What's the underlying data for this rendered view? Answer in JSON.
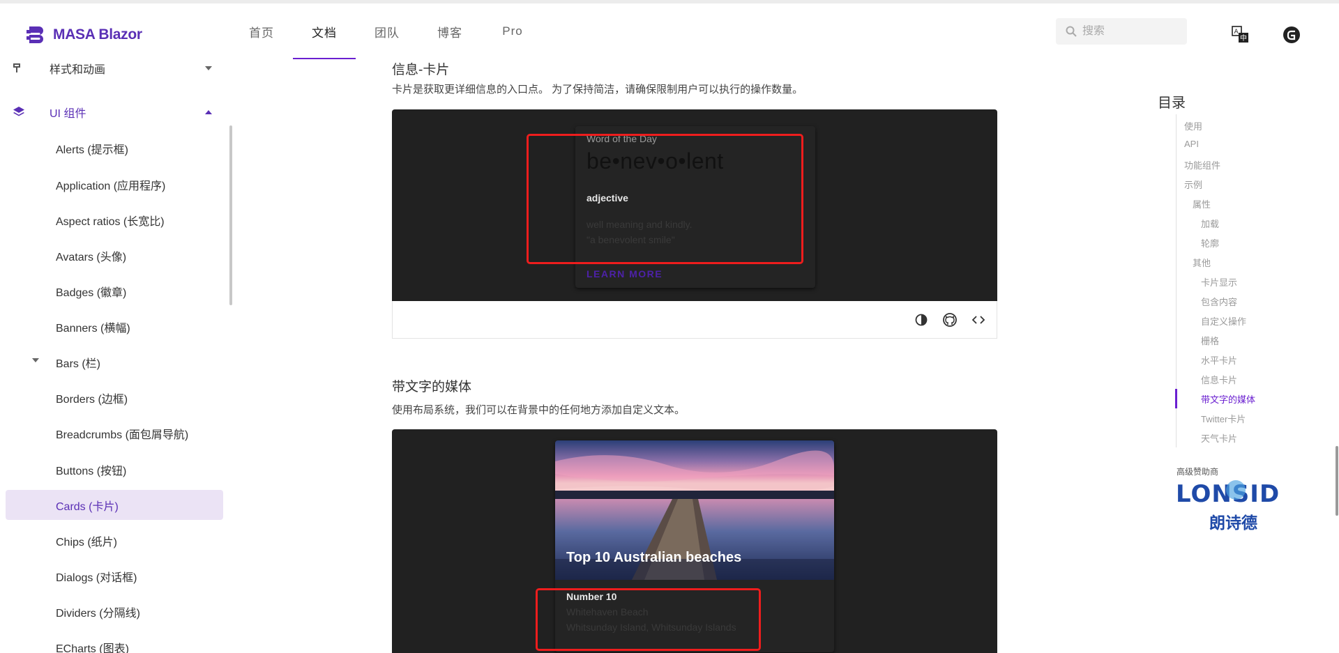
{
  "brand": {
    "name": "MASA Blazor",
    "color": "#5a2fb5",
    "accent": "#6a1fd0"
  },
  "nav": [
    {
      "label": "首页"
    },
    {
      "label": "文档",
      "active": true
    },
    {
      "label": "团队"
    },
    {
      "label": "博客"
    },
    {
      "label": "Pro"
    }
  ],
  "search": {
    "placeholder": "搜索",
    "icon": "search-icon"
  },
  "header_icons": [
    "translate-icon",
    "gitee-icon"
  ],
  "sidebar": {
    "group_prev": {
      "label": "样式和动画",
      "icon": "palette-icon"
    },
    "group": {
      "label": "UI 组件",
      "icon": "layers-icon"
    },
    "items": [
      {
        "label": "Alerts (提示框)"
      },
      {
        "label": "Application (应用程序)"
      },
      {
        "label": "Aspect ratios (长宽比)"
      },
      {
        "label": "Avatars (头像)"
      },
      {
        "label": "Badges (徽章)"
      },
      {
        "label": "Banners (横幅)"
      },
      {
        "label": "Bars (栏)",
        "expandable": true
      },
      {
        "label": "Borders (边框)"
      },
      {
        "label": "Breadcrumbs (面包屑导航)"
      },
      {
        "label": "Buttons (按钮)"
      },
      {
        "label": "Cards (卡片)",
        "active": true
      },
      {
        "label": "Chips (纸片)"
      },
      {
        "label": "Dialogs (对话框)"
      },
      {
        "label": "Dividers (分隔线)"
      },
      {
        "label": "ECharts (图表)"
      }
    ]
  },
  "sections": {
    "info_card": {
      "title": "信息-卡片",
      "desc": "卡片是获取更详细信息的入口点。 为了保持简洁，请确保限制用户可以执行的操作数量。",
      "card": {
        "overline": "Word of the Day",
        "word": "be•nev•o•lent",
        "part_of_speech": "adjective",
        "definition": "well meaning and kindly.",
        "example": "\"a benevolent smile\"",
        "action": "LEARN MORE"
      },
      "toolbar": [
        "theme-toggle-icon",
        "github-icon",
        "code-icon"
      ]
    },
    "media_text": {
      "title": "带文字的媒体",
      "desc": "使用布局系统，我们可以在背景中的任何地方添加自定义文本。",
      "card": {
        "image_title": "Top 10 Australian beaches",
        "subtitle": "Number 10",
        "line1": "Whitehaven Beach",
        "line2": "Whitsunday Island, Whitsunday Islands"
      }
    }
  },
  "toc": {
    "title": "目录",
    "items": [
      {
        "label": "使用",
        "level": 0
      },
      {
        "label": "API",
        "level": 0
      },
      {
        "label": "功能组件",
        "level": 0
      },
      {
        "label": "示例",
        "level": 0
      },
      {
        "label": "属性",
        "level": 1
      },
      {
        "label": "加载",
        "level": 2
      },
      {
        "label": "轮廓",
        "level": 2
      },
      {
        "label": "其他",
        "level": 1
      },
      {
        "label": "卡片显示",
        "level": 2
      },
      {
        "label": "包含内容",
        "level": 2
      },
      {
        "label": "自定义操作",
        "level": 2
      },
      {
        "label": "栅格",
        "level": 2
      },
      {
        "label": "水平卡片",
        "level": 2
      },
      {
        "label": "信息卡片",
        "level": 2
      },
      {
        "label": "带文字的媒体",
        "level": 2,
        "active": true
      },
      {
        "label": "Twitter卡片",
        "level": 2
      },
      {
        "label": "天气卡片",
        "level": 2
      }
    ]
  },
  "sponsor": {
    "label": "高级赞助商",
    "name_en": "LONSID",
    "name_cn": "朗诗德"
  }
}
